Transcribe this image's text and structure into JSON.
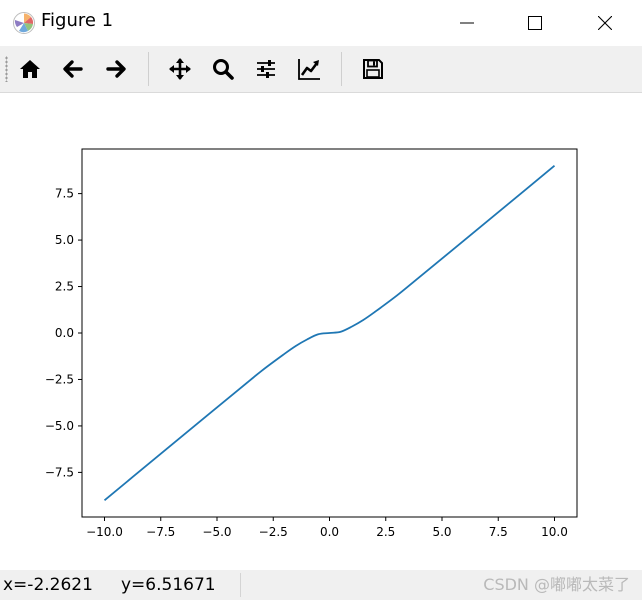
{
  "window": {
    "title": "Figure 1"
  },
  "toolbar": {
    "tools": [
      "home-icon",
      "back-arrow-icon",
      "forward-arrow-icon",
      "pan-icon",
      "zoom-icon",
      "configure-subplots-icon",
      "edit-axis-icon",
      "save-icon"
    ]
  },
  "status": {
    "x_readout": "x=-2.2621",
    "y_readout": "y=6.51671",
    "watermark": "CSDN @嘟嘟太菜了"
  },
  "colors": {
    "line": "#1f77b4",
    "toolbar_bg": "#f0f0f0"
  },
  "chart_data": {
    "type": "line",
    "title": "",
    "xlabel": "",
    "ylabel": "",
    "xlim": [
      -11,
      11
    ],
    "ylim": [
      -9.9,
      9.9
    ],
    "xticks": [
      -10.0,
      -7.5,
      -5.0,
      -2.5,
      0.0,
      2.5,
      5.0,
      7.5,
      10.0
    ],
    "xtick_labels": [
      "−10.0",
      "−7.5",
      "−5.0",
      "−2.5",
      "0.0",
      "2.5",
      "5.0",
      "7.5",
      "10.0"
    ],
    "yticks": [
      -7.5,
      -5.0,
      -2.5,
      0.0,
      2.5,
      5.0,
      7.5
    ],
    "ytick_labels": [
      "−7.5",
      "−5.0",
      "−2.5",
      "0.0",
      "2.5",
      "5.0",
      "7.5"
    ],
    "grid": false,
    "series": [
      {
        "color": "#1f77b4",
        "x": [
          -10.0,
          -8.0,
          -6.0,
          -4.0,
          -3.0,
          -2.0,
          -1.5,
          -1.0,
          -0.5,
          0.0,
          0.5,
          1.0,
          1.5,
          2.0,
          3.0,
          4.0,
          6.0,
          8.0,
          10.0
        ],
        "y": [
          -9.0,
          -7.0,
          -5.0,
          -3.01,
          -2.02,
          -1.12,
          -0.7,
          -0.35,
          -0.07,
          0.0,
          0.07,
          0.35,
          0.7,
          1.12,
          2.02,
          3.01,
          5.0,
          7.0,
          9.0
        ]
      }
    ]
  }
}
